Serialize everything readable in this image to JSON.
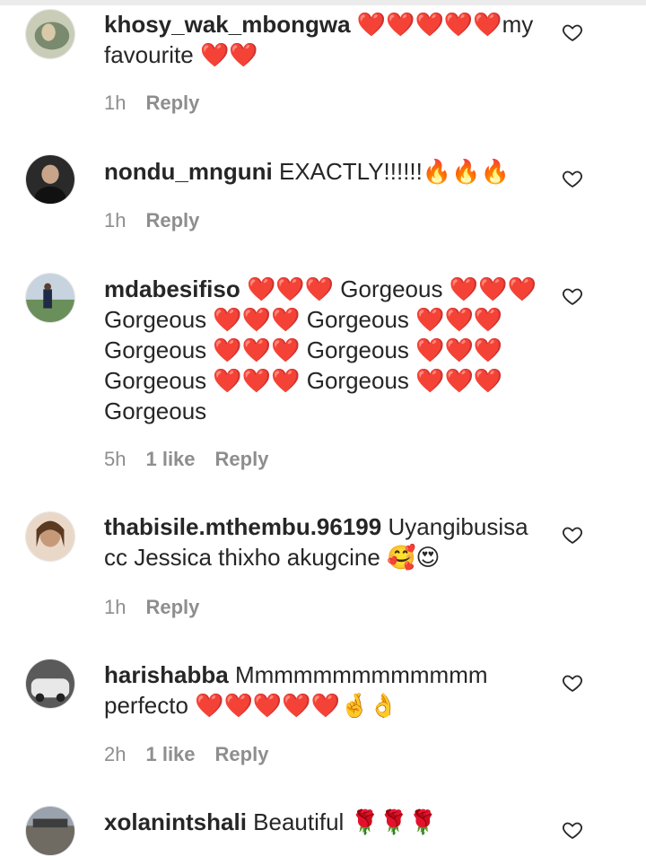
{
  "comments": [
    {
      "username": "khosy_wak_mbongwa",
      "text": "❤️❤️❤️❤️❤️my favourite ❤️❤️",
      "time": "1h",
      "likes": "",
      "reply_label": "Reply",
      "avatar_color": "#7a8a6e"
    },
    {
      "username": "nondu_mnguni",
      "text": "EXACTLY!!!!!!🔥🔥🔥",
      "time": "1h",
      "likes": "",
      "reply_label": "Reply",
      "avatar_color": "#1e1e1e"
    },
    {
      "username": "mdabesifiso",
      "text": "❤️❤️❤️ Gorgeous ❤️❤️❤️ Gorgeous ❤️❤️❤️ Gorgeous ❤️❤️❤️ Gorgeous ❤️❤️❤️ Gorgeous ❤️❤️❤️ Gorgeous ❤️❤️❤️ Gorgeous ❤️❤️❤️ Gorgeous",
      "time": "5h",
      "likes": "1 like",
      "reply_label": "Reply",
      "avatar_color": "#6b8f5a"
    },
    {
      "username": "thabisile.mthembu.96199",
      "text": "Uyangibusisa cc Jessica thixho akugcine 🥰😍",
      "time": "1h",
      "likes": "",
      "reply_label": "Reply",
      "avatar_color": "#c69a78"
    },
    {
      "username": "harishabba",
      "text": "Mmmmmmmmmmmmm perfecto ❤️❤️❤️❤️❤️🤞👌",
      "time": "2h",
      "likes": "1 like",
      "reply_label": "Reply",
      "avatar_color": "#9a9a9a"
    },
    {
      "username": "xolanintshali",
      "text": "Beautiful 🌹🌹🌹",
      "time": "",
      "likes": "",
      "reply_label": "",
      "avatar_color": "#6f6a62"
    }
  ]
}
